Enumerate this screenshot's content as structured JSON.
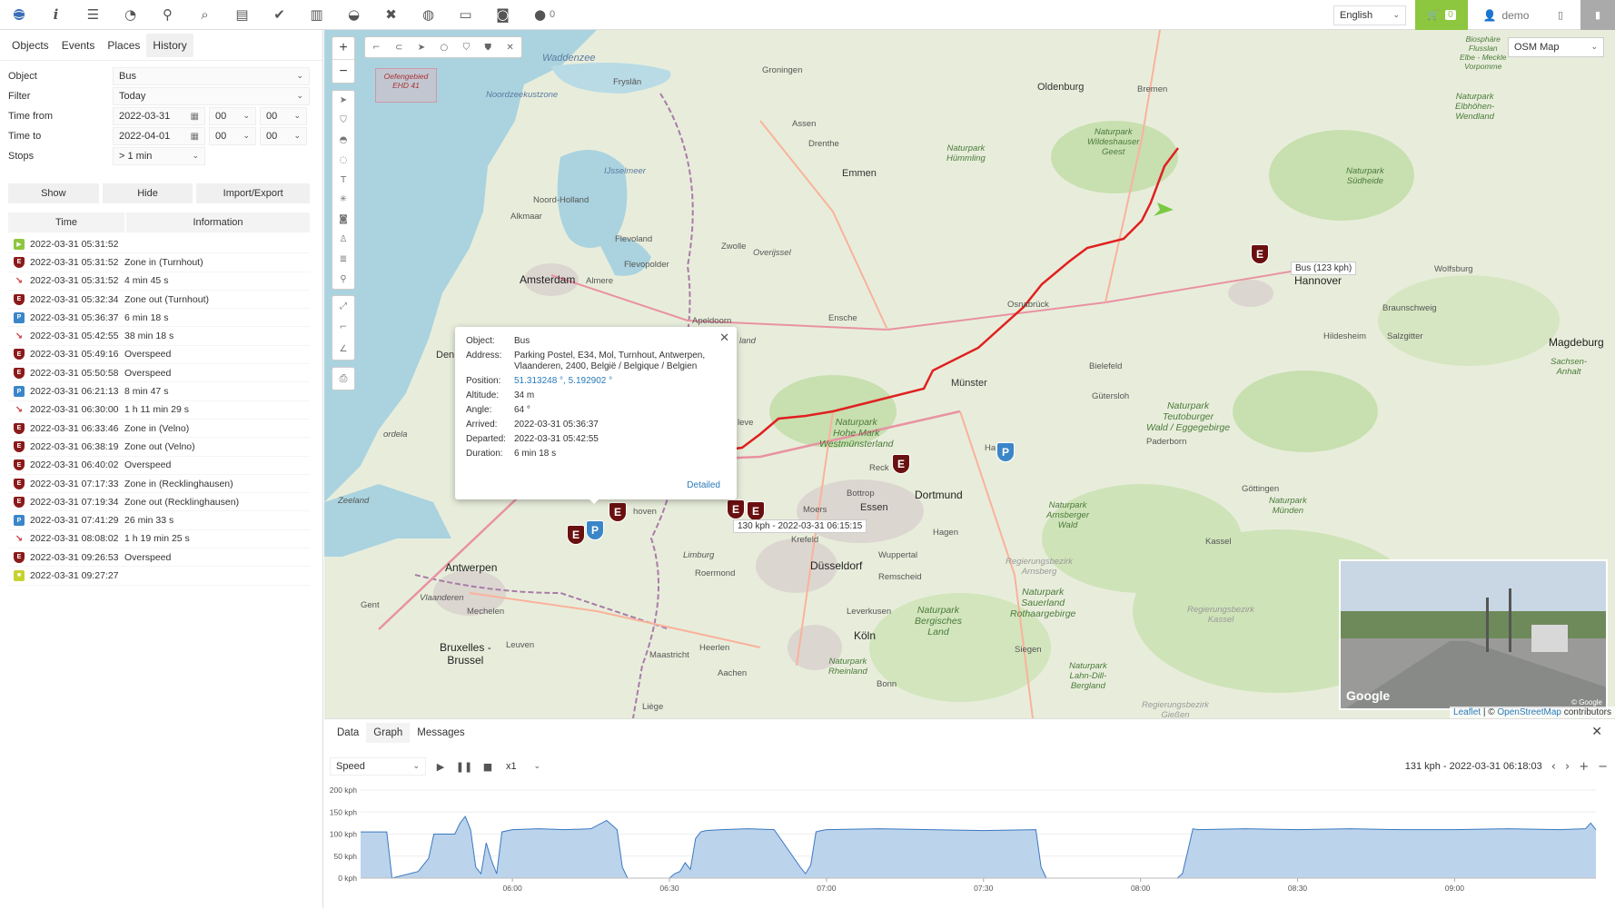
{
  "toolbar": {
    "icons": [
      "globe-icon",
      "info-icon",
      "sliders-icon",
      "dashboard-icon",
      "marker-icon",
      "search-icon",
      "chart-icon",
      "check-icon",
      "book-icon",
      "vehicle-icon",
      "tools-icon",
      "database-icon",
      "window-icon",
      "camera-icon",
      "chat-icon"
    ],
    "chat_count": "0",
    "language": "English",
    "cart_count": "0",
    "user": "demo"
  },
  "left_tabs": [
    "Objects",
    "Events",
    "Places",
    "History"
  ],
  "filters": {
    "object_label": "Object",
    "object_value": "Bus",
    "filter_label": "Filter",
    "filter_value": "Today",
    "time_from_label": "Time from",
    "time_from_date": "2022-03-31",
    "time_from_h": "00",
    "time_from_m": "00",
    "time_to_label": "Time to",
    "time_to_date": "2022-04-01",
    "time_to_h": "00",
    "time_to_m": "00",
    "stops_label": "Stops",
    "stops_value": "> 1 min"
  },
  "buttons": {
    "show": "Show",
    "hide": "Hide",
    "import_export": "Import/Export"
  },
  "history_header": {
    "time": "Time",
    "info": "Information"
  },
  "history": [
    {
      "type": "start",
      "time": "2022-03-31 05:31:52",
      "info": ""
    },
    {
      "type": "event",
      "time": "2022-03-31 05:31:52",
      "info": "Zone in (Turnhout)"
    },
    {
      "type": "move",
      "time": "2022-03-31 05:31:52",
      "info": "4 min 45 s"
    },
    {
      "type": "event",
      "time": "2022-03-31 05:32:34",
      "info": "Zone out (Turnhout)"
    },
    {
      "type": "stop",
      "time": "2022-03-31 05:36:37",
      "info": "6 min 18 s"
    },
    {
      "type": "move",
      "time": "2022-03-31 05:42:55",
      "info": "38 min 18 s"
    },
    {
      "type": "event",
      "time": "2022-03-31 05:49:16",
      "info": "Overspeed"
    },
    {
      "type": "event",
      "time": "2022-03-31 05:50:58",
      "info": "Overspeed"
    },
    {
      "type": "stop",
      "time": "2022-03-31 06:21:13",
      "info": "8 min 47 s"
    },
    {
      "type": "move",
      "time": "2022-03-31 06:30:00",
      "info": "1 h 11 min 29 s"
    },
    {
      "type": "event",
      "time": "2022-03-31 06:33:46",
      "info": "Zone in (Velno)"
    },
    {
      "type": "event",
      "time": "2022-03-31 06:38:19",
      "info": "Zone out (Velno)"
    },
    {
      "type": "event",
      "time": "2022-03-31 06:40:02",
      "info": "Overspeed"
    },
    {
      "type": "event",
      "time": "2022-03-31 07:17:33",
      "info": "Zone in (Recklinghausen)"
    },
    {
      "type": "event",
      "time": "2022-03-31 07:19:34",
      "info": "Zone out (Recklinghausen)"
    },
    {
      "type": "stop",
      "time": "2022-03-31 07:41:29",
      "info": "26 min 33 s"
    },
    {
      "type": "move",
      "time": "2022-03-31 08:08:02",
      "info": "1 h 19 min 25 s"
    },
    {
      "type": "event",
      "time": "2022-03-31 09:26:53",
      "info": "Overspeed"
    },
    {
      "type": "end",
      "time": "2022-03-31 09:27:27",
      "info": ""
    }
  ],
  "map": {
    "layer": "OSM Map",
    "zone_label": "Oefengebied EHD 41",
    "labels": {
      "waddenzee": "Waddenzee",
      "groningen": "Groningen",
      "oldenburg": "Oldenburg",
      "bremen": "Bremen",
      "assen": "Assen",
      "drenthe": "Drenthe",
      "emmen": "Emmen",
      "friesland": "Fryslân",
      "noordzee": "Noordzeekustzone",
      "ijsselmeer": "IJsselmeer",
      "noord_holland": "Noord-Holland",
      "alkmaar": "Alkmaar",
      "flevoland": "Flevoland",
      "flevopolder": "Flevopolder",
      "zwolle": "Zwolle",
      "overijssel": "Overijssel",
      "amsterdam": "Amsterdam",
      "almere": "Almere",
      "apeldoorn": "Apeldoorn",
      "enschede": "Enschede",
      "osnabrueck": "Osnabrück",
      "hannover": "Hannover",
      "wolfsburg": "Wolfsburg",
      "braunschweig": "Braunschweig",
      "hildesheim": "Hildesheim",
      "salzgitter": "Salzgitter",
      "magdeburg": "Magdeburg",
      "bielefeld": "Bielefeld",
      "guetersloh": "Gütersloh",
      "paderborn": "Paderborn",
      "muenster": "Münster",
      "dortmund": "Dortmund",
      "essen": "Essen",
      "bottrop": "Bottrop",
      "moers": "Moers",
      "krefeld": "Krefeld",
      "duesseldorf": "Düsseldorf",
      "wuppertal": "Wuppertal",
      "hagen": "Hagen",
      "remscheid": "Remscheid",
      "leverkusen": "Leverkusen",
      "koeln": "Köln",
      "bonn": "Bonn",
      "siegen": "Siegen",
      "kassel": "Kassel",
      "goettingen": "Göttingen",
      "antwerpen": "Antwerpen",
      "mechelen": "Mechelen",
      "bruxelles": "Bruxelles -\nBrussel",
      "leuven": "Leuven",
      "gent": "Gent",
      "maastricht": "Maastricht",
      "heerlen": "Heerlen",
      "aachen": "Aachen",
      "liege": "Liège",
      "limburg": "Limburg",
      "roermond": "Roermond",
      "eindhoven": "hoven",
      "zeeland": "Zeeland",
      "vlaanderen": "Vlaanderen",
      "den": "Den",
      "nordela": "ordela",
      "leve": "leve",
      "land": "land",
      "reck": "Reck",
      "ham": "Ha",
      "enschede_small": "Ensche",
      "sachsen_anhalt": "Sachsen-\nAnhalt",
      "np_wildeshauser": "Naturpark\nWildeshauser\nGeest",
      "np_huemmling": "Naturpark\nHümmling",
      "np_suedheide": "Naturpark\nSüdheide",
      "np_elbhoehen": "Naturpark\nElbhöhen-\nWendland",
      "np_teutoburger": "Naturpark\nTeutoburger\nWald / Eggegebirge",
      "np_hohe_mark": "Naturpark\nHohe Mark\nWestmünsterland",
      "np_arnsberger": "Naturpark\nArnsberger\nWald",
      "np_sauerland": "Naturpark\nSauerland\nRothaargebirge",
      "np_bergisches": "Naturpark\nBergisches\nLand",
      "np_rheinland": "Naturpark\nRheinland",
      "np_lahn_dill": "Naturpark\nLahn-Dill-\nBergland",
      "np_muenden": "Naturpark\nMünden",
      "rb_arnsberg": "Regierungsbezirk\nArnsberg",
      "rb_kassel": "Regierungsbezirk\nKassel",
      "rb_giessen": "Regierungsbezirk\nGießen",
      "biosphaere": "Biosphäre\nFlusslan\nElbe - Meckle\nVorpomme"
    },
    "popup": {
      "object_label": "Object:",
      "object_value": "Bus",
      "address_label": "Address:",
      "address_value": "Parking Postel, E34, Mol, Turnhout, Antwerpen, Vlaanderen, 2400, België / Belgique / Belgien",
      "position_label": "Position:",
      "position_value": "51.313248 °, 5.192902 °",
      "altitude_label": "Altitude:",
      "altitude_value": "34 m",
      "angle_label": "Angle:",
      "angle_value": "64 °",
      "arrived_label": "Arrived:",
      "arrived_value": "2022-03-31 05:36:37",
      "departed_label": "Departed:",
      "departed_value": "2022-03-31 05:42:55",
      "duration_label": "Duration:",
      "duration_value": "6 min 18 s",
      "detailed": "Detailed"
    },
    "bus_label": "Bus (123 kph)",
    "speed_tip": "130 kph - 2022-03-31 06:15:15",
    "marker_e": "E",
    "marker_p": "P",
    "attribution_leaflet": "Leaflet",
    "attribution_sep": " | © ",
    "attribution_osm": "OpenStreetMap",
    "attribution_tail": " contributors",
    "google": "Google",
    "google_small": "© Google"
  },
  "bottom": {
    "tabs": [
      "Data",
      "Graph",
      "Messages"
    ],
    "metric": "Speed",
    "multiplier": "x1",
    "status": "131 kph - 2022-03-31 06:18:03"
  },
  "chart_data": {
    "type": "area",
    "ylabel": "",
    "y_ticks": [
      "200 kph",
      "150 kph",
      "100 kph",
      "50 kph",
      "0 kph"
    ],
    "ylim": [
      0,
      200
    ],
    "x_ticks": [
      "06:00",
      "06:30",
      "07:00",
      "07:30",
      "08:00",
      "08:30",
      "09:00"
    ],
    "xlim": [
      "05:31",
      "09:27"
    ],
    "series": [
      {
        "x": [
          "05:31",
          "05:32",
          "05:36",
          "05:37",
          "05:42",
          "05:43",
          "05:44",
          "05:45",
          "05:49",
          "05:50",
          "05:51",
          "05:52",
          "05:53",
          "05:54",
          "05:55",
          "05:56",
          "05:57",
          "05:58",
          "06:00",
          "06:05",
          "06:10",
          "06:15",
          "06:18",
          "06:20",
          "06:21",
          "06:22",
          "06:30",
          "06:31",
          "06:32",
          "06:33",
          "06:34",
          "06:35",
          "06:36",
          "06:37",
          "06:40",
          "06:45",
          "06:50",
          "06:55",
          "06:56",
          "06:57",
          "06:58",
          "06:59",
          "07:00",
          "07:10",
          "07:20",
          "07:30",
          "07:40",
          "07:41",
          "07:42",
          "08:07",
          "08:08",
          "08:09",
          "08:10",
          "08:11",
          "08:20",
          "08:30",
          "08:40",
          "08:50",
          "09:00",
          "09:10",
          "09:20",
          "09:25",
          "09:26",
          "09:27"
        ],
        "values": [
          105,
          105,
          105,
          0,
          15,
          30,
          45,
          100,
          100,
          125,
          140,
          110,
          25,
          10,
          80,
          40,
          10,
          105,
          110,
          112,
          110,
          112,
          131,
          110,
          25,
          0,
          0,
          10,
          15,
          35,
          20,
          90,
          105,
          108,
          110,
          112,
          110,
          25,
          10,
          30,
          105,
          108,
          110,
          112,
          110,
          108,
          110,
          25,
          0,
          0,
          10,
          60,
          112,
          110,
          112,
          110,
          112,
          110,
          110,
          112,
          110,
          112,
          125,
          110
        ]
      }
    ]
  }
}
